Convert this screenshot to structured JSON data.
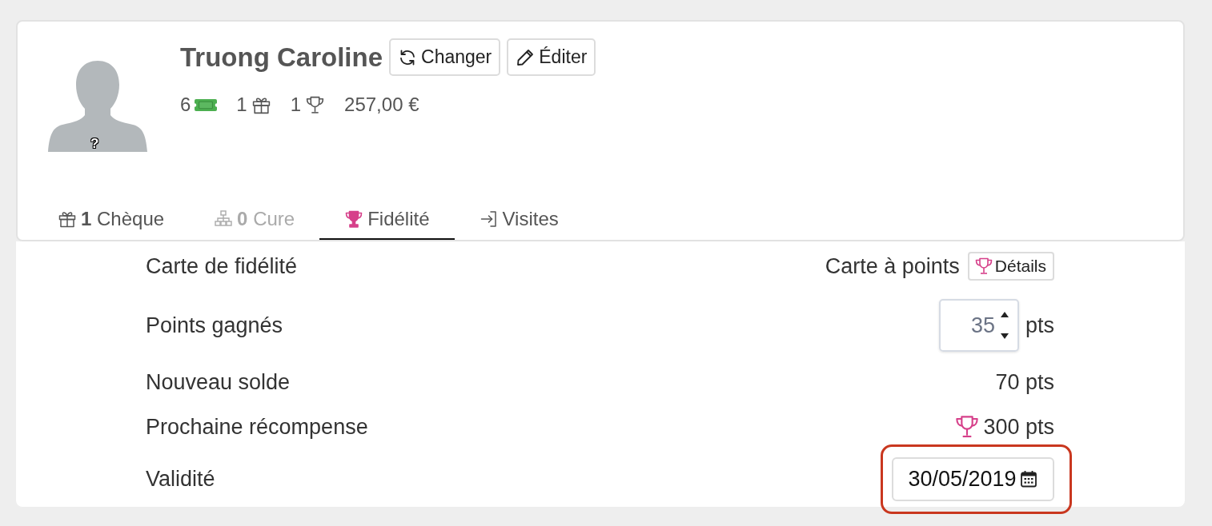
{
  "profile": {
    "name": "Truong Caroline",
    "avatar_mark": "?",
    "actions": [
      {
        "kind": "refresh",
        "label": "Changer"
      },
      {
        "kind": "edit",
        "label": "Éditer"
      }
    ],
    "stats": [
      {
        "kind": "ticket",
        "value": "6"
      },
      {
        "kind": "gift",
        "value": "1"
      },
      {
        "kind": "trophy",
        "value": "1"
      },
      {
        "kind": "amount",
        "value": "257,00 €"
      }
    ]
  },
  "tabs": [
    {
      "kind": "gift",
      "label": "**1** Chèque",
      "selected": false,
      "disabled": false
    },
    {
      "kind": "hierarchy",
      "label": "**0** Cure",
      "selected": false,
      "disabled": true
    },
    {
      "kind": "trophy",
      "label": "Fidélité",
      "selected": true,
      "disabled": false
    },
    {
      "kind": "enter",
      "label": "Visites",
      "selected": false,
      "disabled": false
    }
  ],
  "loyalty": {
    "rows": [
      {
        "kind": "card",
        "label": "Carte de fidélité",
        "value": "Carte à points",
        "button": "Détails",
        "highlighted": false
      },
      {
        "kind": "number",
        "label": "Points gagnés",
        "value": "35",
        "unit": "pts",
        "highlighted": false
      },
      {
        "kind": "text",
        "label": "Nouveau solde",
        "value": "70 pts",
        "highlighted": false
      },
      {
        "kind": "reward",
        "label": "Prochaine récompense",
        "value": "300 pts",
        "highlighted": false
      },
      {
        "kind": "date",
        "label": "Validité",
        "value": "30/05/2019",
        "highlighted": true
      }
    ]
  }
}
